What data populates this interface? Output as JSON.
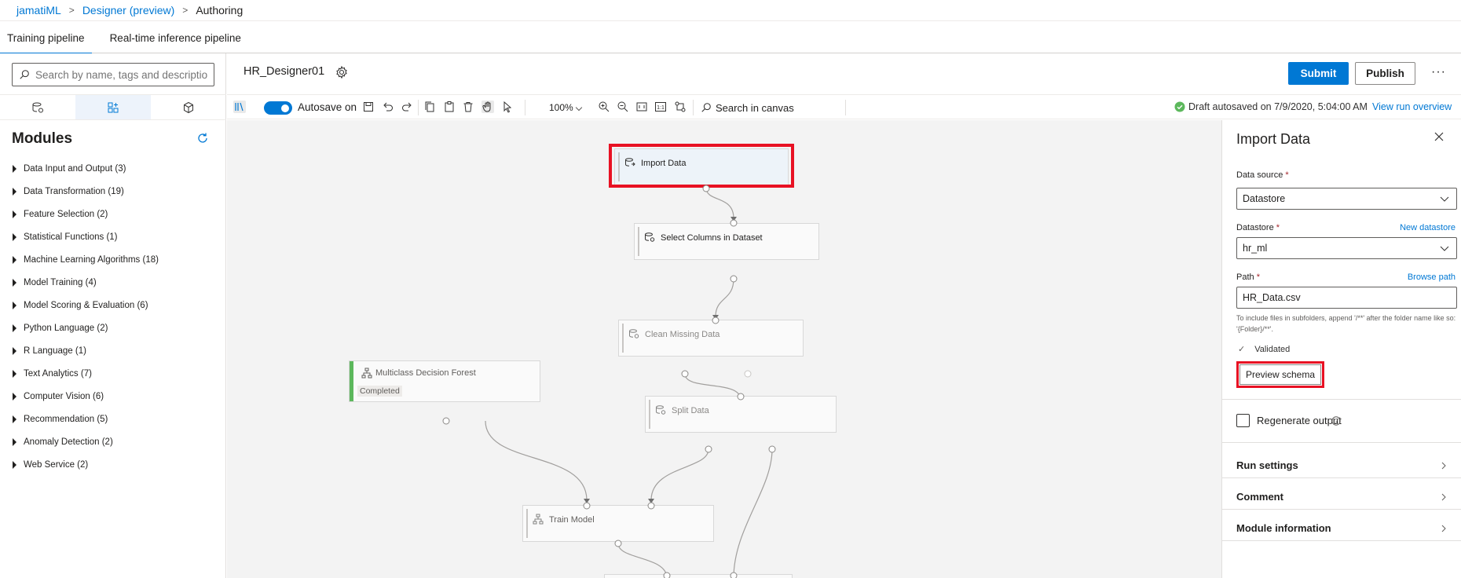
{
  "breadcrumb": {
    "items": [
      "jamatiML",
      "Designer (preview)",
      "Authoring"
    ]
  },
  "tabs": [
    "Training pipeline",
    "Real-time inference pipeline"
  ],
  "search": {
    "placeholder": "Search by name, tags and description"
  },
  "sidebar": {
    "title": "Modules",
    "modules": [
      "Data Input and Output (3)",
      "Data Transformation (19)",
      "Feature Selection (2)",
      "Statistical Functions (1)",
      "Machine Learning Algorithms (18)",
      "Model Training (4)",
      "Model Scoring & Evaluation (6)",
      "Python Language (2)",
      "R Language (1)",
      "Text Analytics (7)",
      "Computer Vision (6)",
      "Recommendation (5)",
      "Anomaly Detection (2)",
      "Web Service (2)"
    ]
  },
  "header": {
    "pipeline_name": "HR_Designer01",
    "submit_label": "Submit",
    "publish_label": "Publish",
    "more_label": "···"
  },
  "toolbar": {
    "autosave_label": "Autosave on",
    "zoom": "100%",
    "search_canvas": "Search in canvas",
    "draft_status": "Draft autosaved on 7/9/2020, 5:04:00 AM",
    "run_overview": "View run overview"
  },
  "canvas": {
    "nodes": {
      "import_data": "Import Data",
      "select_columns": "Select Columns in Dataset",
      "clean_missing": "Clean Missing Data",
      "decision_forest": "Multiclass Decision Forest",
      "decision_forest_status": "Completed",
      "split_data": "Split Data",
      "train_model": "Train Model"
    }
  },
  "panel": {
    "title": "Import Data",
    "data_source_label": "Data source",
    "data_source_value": "Datastore",
    "datastore_label": "Datastore",
    "new_datastore": "New datastore",
    "datastore_value": "hr_ml",
    "path_label": "Path",
    "browse_path": "Browse path",
    "path_value": "HR_Data.csv",
    "help_text": "To include files in subfolders, append '/**' after the folder name like so: '{Folder}/**'.",
    "validated": "Validated",
    "preview_schema": "Preview schema",
    "regenerate_output": "Regenerate output",
    "run_settings": "Run settings",
    "comment": "Comment",
    "module_information": "Module information",
    "required_mark": "*"
  },
  "colors": {
    "accent": "#0078d4",
    "highlight": "#e81123",
    "completed": "#5cb85c"
  }
}
